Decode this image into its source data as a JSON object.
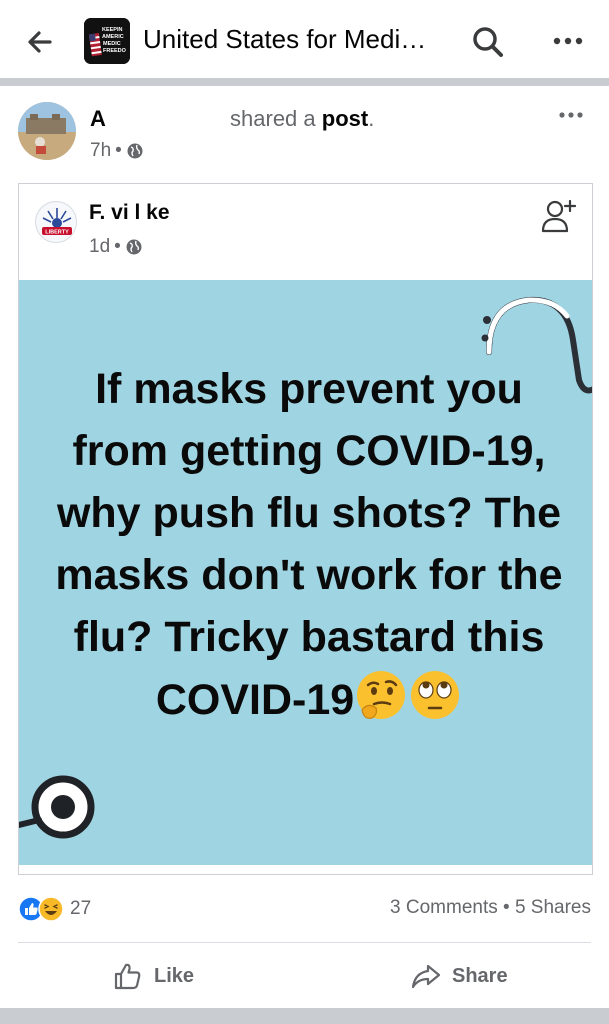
{
  "header": {
    "title": "United States for Medi…",
    "back_icon": "back-arrow-icon",
    "search_icon": "search-icon",
    "more_icon": "more-dots-icon",
    "logo_text": [
      "KEEPIN",
      "AMERIC",
      "MEDIC",
      "FREEDO"
    ]
  },
  "post": {
    "sharer_name_visible": "A",
    "shared_text": "shared a",
    "shared_object": "post",
    "shared_period": ".",
    "time": "7h",
    "audience_icon": "globe-icon",
    "more_icon": "more-dots-icon"
  },
  "shared_post": {
    "author_partial": "F. vi l     ke",
    "time": "1d",
    "audience_icon": "globe-icon",
    "follow_icon": "add-friend-icon",
    "logo_text": "LIBERTY",
    "meme_text": "If masks prevent you from getting COVID-19, why push flu shots? The masks don't work for the flu? Tricky bastard this COVID-19",
    "emojis": [
      "thinking-face-emoji",
      "eye-roll-emoji"
    ]
  },
  "engagement": {
    "reaction_icons": [
      "like-reaction-icon",
      "haha-reaction-icon"
    ],
    "reaction_count": "27",
    "comments": "3 Comments",
    "separator": "•",
    "shares": "5 Shares"
  },
  "actions": {
    "like_label": "Like",
    "share_label": "Share"
  },
  "colors": {
    "meme_background": "#9fd4e2",
    "like_blue": "#1877f2",
    "haha_yellow": "#f7b928",
    "muted_text": "#65676b"
  }
}
